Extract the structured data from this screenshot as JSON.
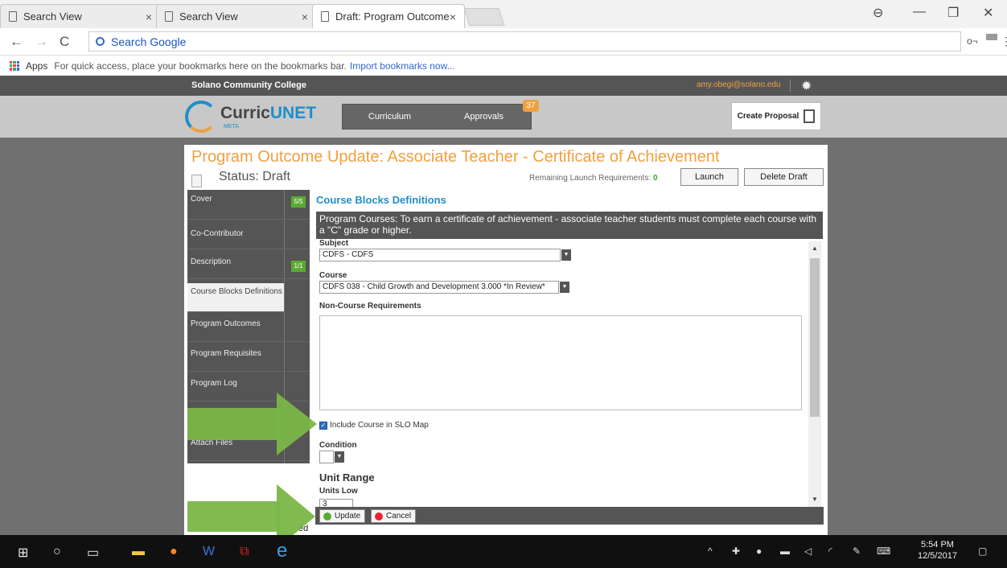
{
  "browser": {
    "tabs": [
      {
        "title": "Search View"
      },
      {
        "title": "Search View"
      },
      {
        "title": "Draft: Program Outcome"
      }
    ],
    "omnibox": {
      "placeholder": "Search Google"
    },
    "bookmarks": {
      "apps_label": "Apps",
      "hint": "For quick access, place your bookmarks here on the bookmarks bar.",
      "import_link": "Import bookmarks now..."
    }
  },
  "site": {
    "college": "Solano Community College",
    "email": "amy.obegi@solano.edu",
    "logo_prefix": "Curric",
    "logo_suffix": "UNET",
    "logo_sub": "META",
    "menu": {
      "curriculum": "Curriculum",
      "approvals": "Approvals",
      "approvals_count": "37"
    },
    "create_proposal": "Create Proposal"
  },
  "proposal": {
    "title": "Program Outcome Update: Associate Teacher - Certificate of Achievement",
    "status": "Status: Draft",
    "remaining_label": "Remaining Launch Requirements:",
    "remaining_count": "0",
    "launch": "Launch",
    "delete_draft": "Delete Draft"
  },
  "leftnav": [
    {
      "label": "Cover",
      "count": "5/5"
    },
    {
      "label": "Co-Contributor",
      "count": ""
    },
    {
      "label": "Description",
      "count": "1/1"
    },
    {
      "label": "Course Blocks Definitions",
      "count": ""
    },
    {
      "label": "Program Outcomes",
      "count": ""
    },
    {
      "label": "Program Requisites",
      "count": ""
    },
    {
      "label": "Program Log",
      "count": ""
    },
    {
      "label": "",
      "count": ""
    },
    {
      "label": "Attach Files",
      "count": ""
    }
  ],
  "form": {
    "section_title": "Course Blocks Definitions",
    "instructions": "Program Courses: To earn a certificate of achievement - associate teacher students must complete each course with a \"C\" grade or higher.",
    "subject_label": "Subject",
    "subject_value": "CDFS - CDFS",
    "course_label": "Course",
    "course_value": "CDFS 038 - Child Growth and Development 3.000  *In Review*",
    "noncourse_label": "Non-Course Requirements",
    "include_slo": "Include Course in SLO Map",
    "condition_label": "Condition",
    "unit_range": "Unit Range",
    "units_low_label": "Units Low",
    "units_low_value": "3"
  },
  "actions": {
    "update": "Update",
    "cancel": "Cancel"
  },
  "footer_fragment": "ed",
  "taskbar": {
    "time": "5:54 PM",
    "date": "12/5/2017"
  },
  "colors": {
    "accent_orange": "#f0a040",
    "accent_blue": "#1f8fc8",
    "count_green": "#5bab32",
    "arrow_green": "#7ab648"
  }
}
